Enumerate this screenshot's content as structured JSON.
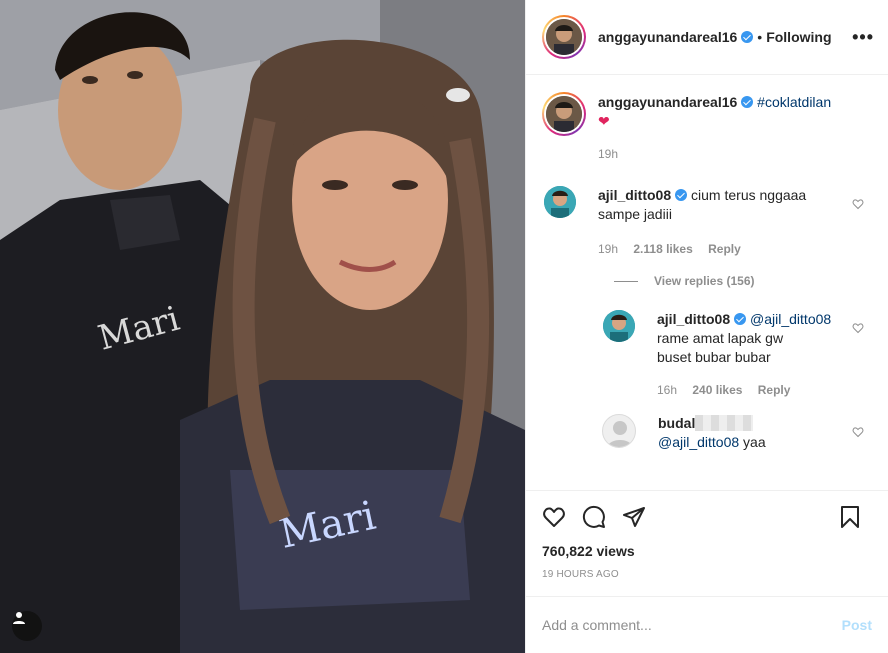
{
  "post": {
    "author": "anggayunandareal16",
    "follow_status": "Following",
    "more_icon": "more-options-icon",
    "caption_hashtag": "#coklatdilan",
    "caption_emoji": "❤",
    "caption_time": "19h"
  },
  "comments": [
    {
      "username": "ajil_ditto08",
      "text_line1": "cium terus nggaaa",
      "text_line2": "sampe jadiii",
      "time": "19h",
      "likes": "2.118 likes",
      "reply": "Reply",
      "view_replies": "View replies (156)"
    }
  ],
  "replies": [
    {
      "username": "ajil_ditto08",
      "mention": "@ajil_ditto08",
      "text_line1": "rame amat lapak gw",
      "text_line2": "buset bubar bubar",
      "time": "16h",
      "likes": "240 likes",
      "reply": "Reply"
    },
    {
      "username": "budal",
      "mention": "@ajil_ditto08",
      "text": "yaa"
    }
  ],
  "stats": {
    "views": "760,822 views",
    "time_ago": "19 HOURS AGO"
  },
  "comment_box": {
    "placeholder": "Add a comment...",
    "post_label": "Post"
  },
  "colors": {
    "link": "#00376b",
    "verified": "#3897f0",
    "muted": "#8e8e8e",
    "post_disabled": "#b2dffc"
  }
}
